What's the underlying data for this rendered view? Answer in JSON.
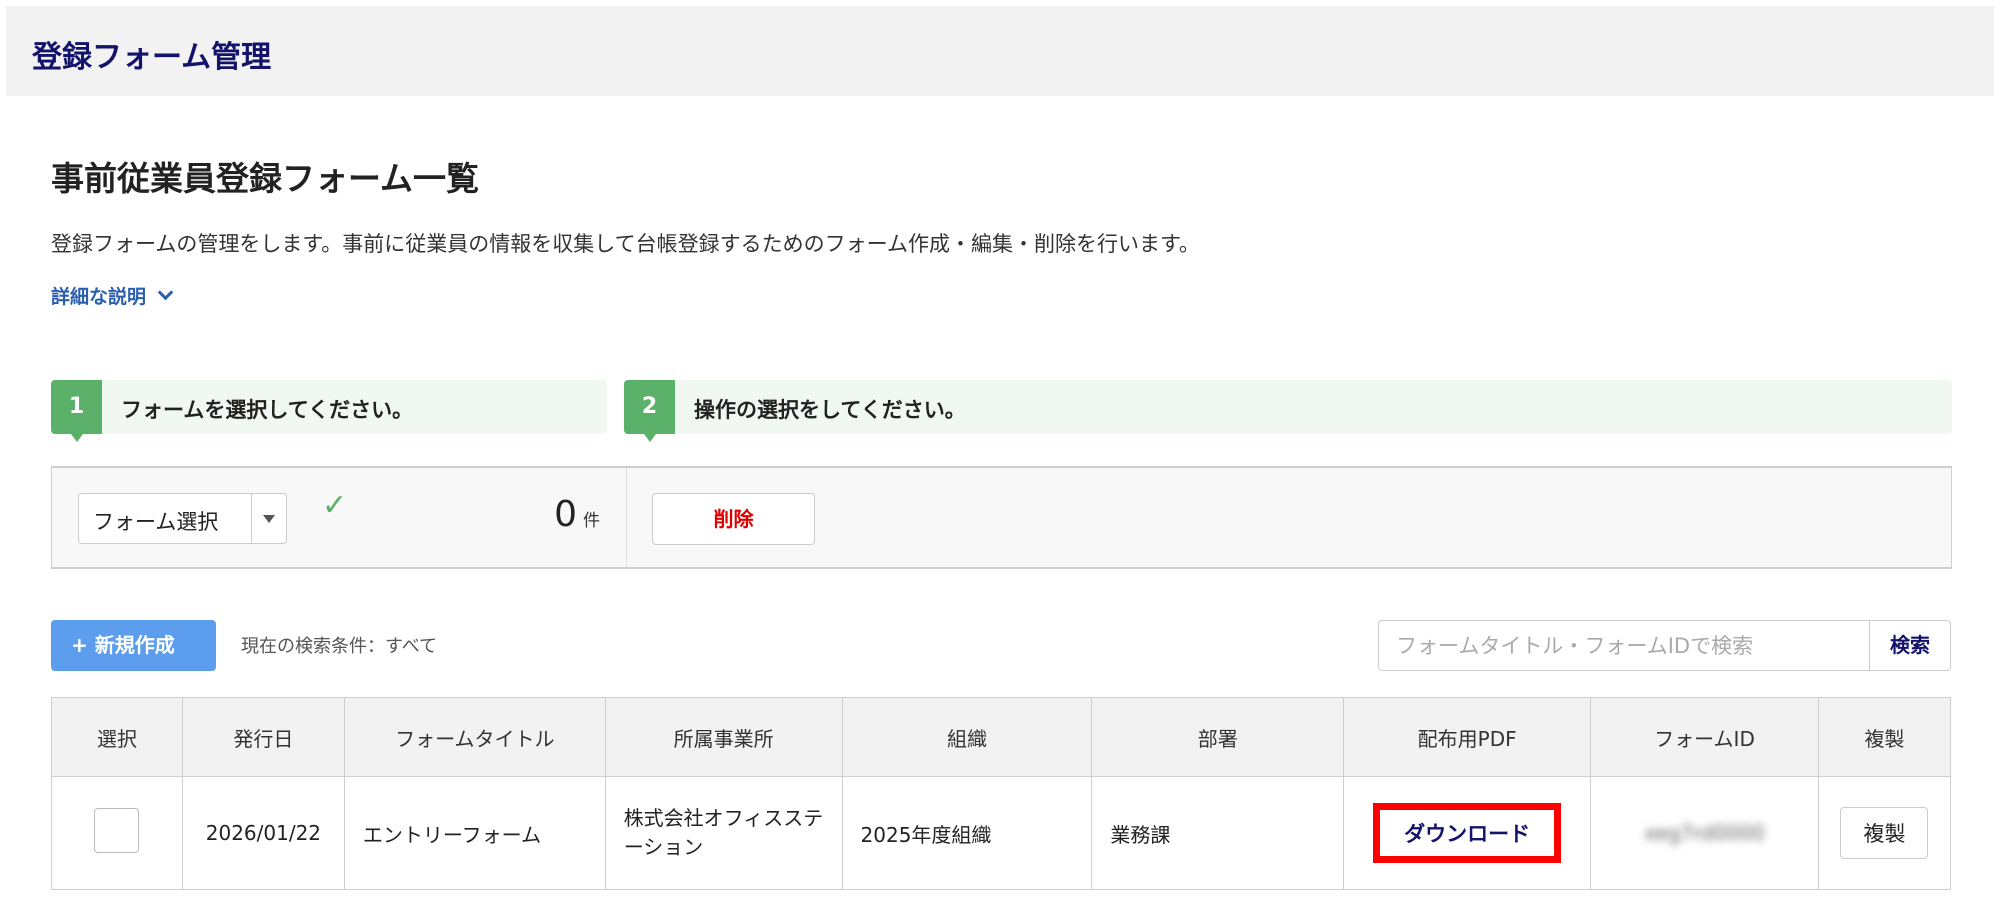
{
  "header": {
    "title": "登録フォーム管理"
  },
  "page": {
    "title": "事前従業員登録フォーム一覧",
    "description": "登録フォームの管理をします。事前に従業員の情報を収集して台帳登録するためのフォーム作成・編集・削除を行います。",
    "details_link": "詳細な説明"
  },
  "steps": [
    {
      "number": "1",
      "label": "フォームを選択してください。"
    },
    {
      "number": "2",
      "label": "操作の選択をしてください。"
    }
  ],
  "panel": {
    "select_value": "フォーム選択",
    "count": "0",
    "count_unit": "件",
    "delete_label": "削除"
  },
  "toolbar": {
    "new_label": "+ 新規作成",
    "condition": "現在の検索条件：すべて",
    "search_placeholder": "フォームタイトル・フォームIDで検索",
    "search_button": "検索"
  },
  "table": {
    "headers": [
      "選択",
      "発行日",
      "フォームタイトル",
      "所属事業所",
      "組織",
      "部署",
      "配布用PDF",
      "フォームID",
      "複製"
    ],
    "rows": [
      {
        "date": "2026/01/22",
        "title": "エントリーフォーム",
        "office": "株式会社オフィスステーション",
        "org": "2025年度組織",
        "dept": "業務課",
        "pdf": "ダウンロード",
        "form_id": "xeg7rd0000",
        "copy": "複製"
      }
    ]
  }
}
